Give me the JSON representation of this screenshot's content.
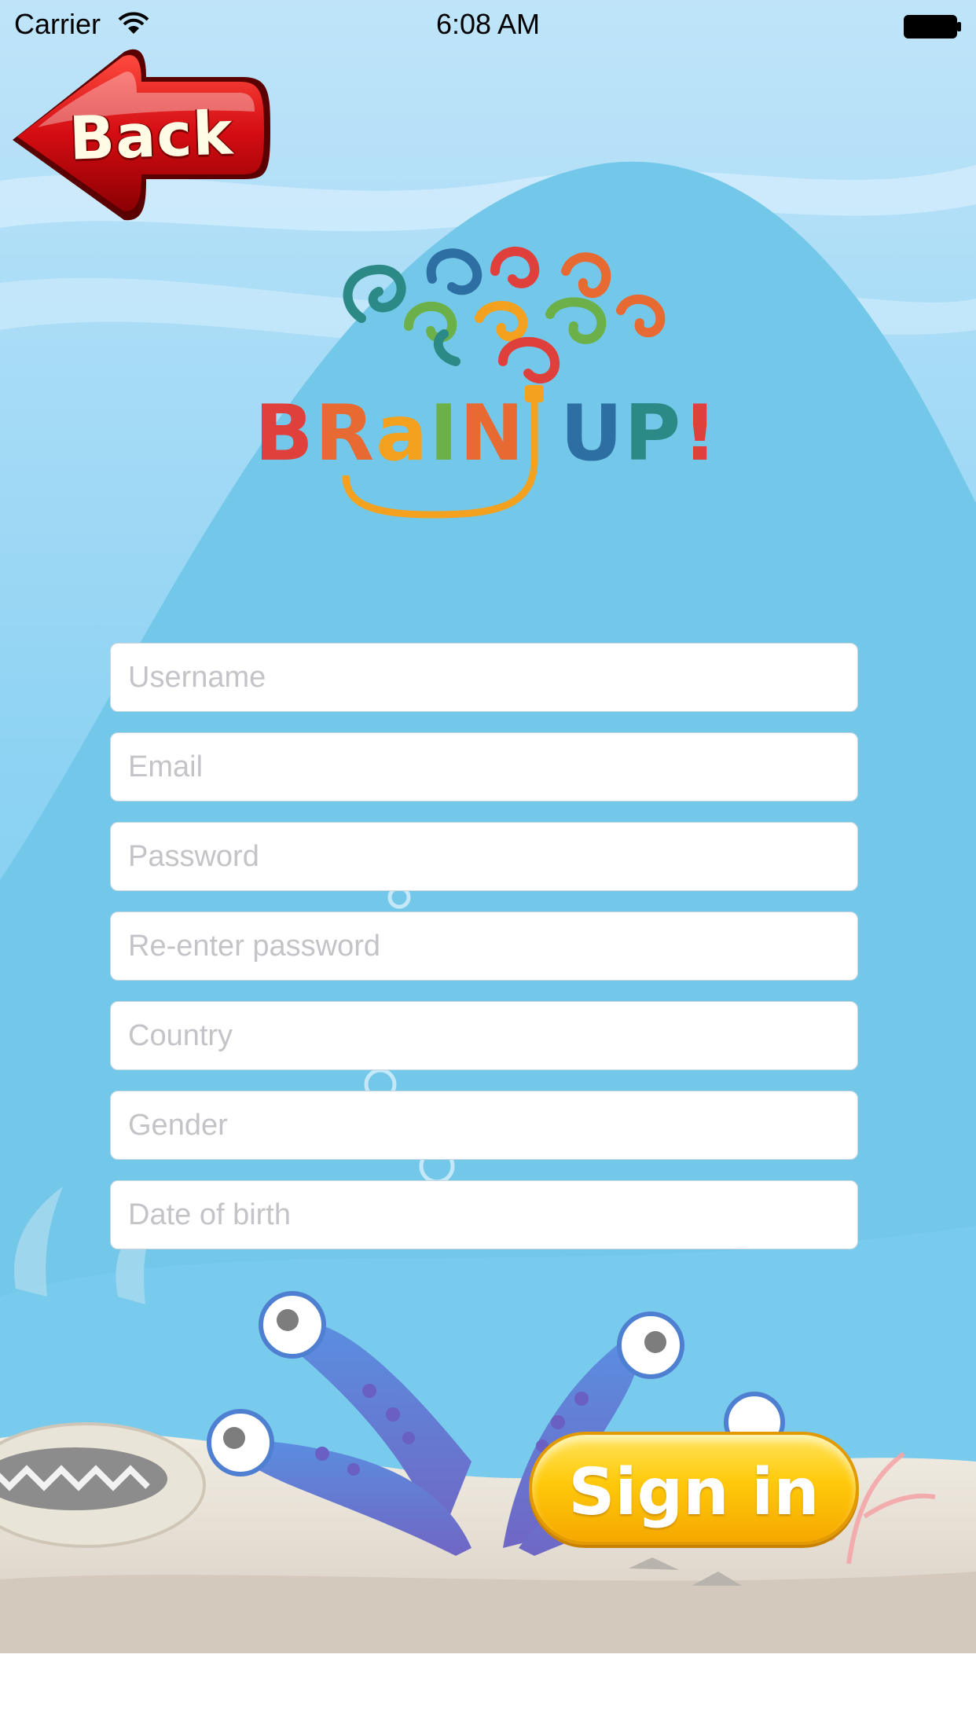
{
  "status_bar": {
    "carrier": "Carrier",
    "time": "6:08 AM",
    "icons": [
      "wifi-icon",
      "battery-icon"
    ]
  },
  "back_button": {
    "label": "Back"
  },
  "logo": {
    "text": "BRaIN UP!",
    "icon": "brain-swirl-icon"
  },
  "form": {
    "username": {
      "placeholder": "Username",
      "value": ""
    },
    "email": {
      "placeholder": "Email",
      "value": ""
    },
    "password": {
      "placeholder": "Password",
      "value": ""
    },
    "reenter_password": {
      "placeholder": "Re-enter password",
      "value": ""
    },
    "country": {
      "placeholder": "Country",
      "value": ""
    },
    "gender": {
      "placeholder": "Gender",
      "value": ""
    },
    "date_of_birth": {
      "placeholder": "Date of birth",
      "value": ""
    }
  },
  "sign_in_button": {
    "label": "Sign in"
  },
  "colors": {
    "sky_top": "#b8e0f7",
    "hill": "#79c9ea",
    "sand": "#ece7dc",
    "back_red": "#d10f14",
    "sign_in_yellow": "#ffc90a"
  }
}
